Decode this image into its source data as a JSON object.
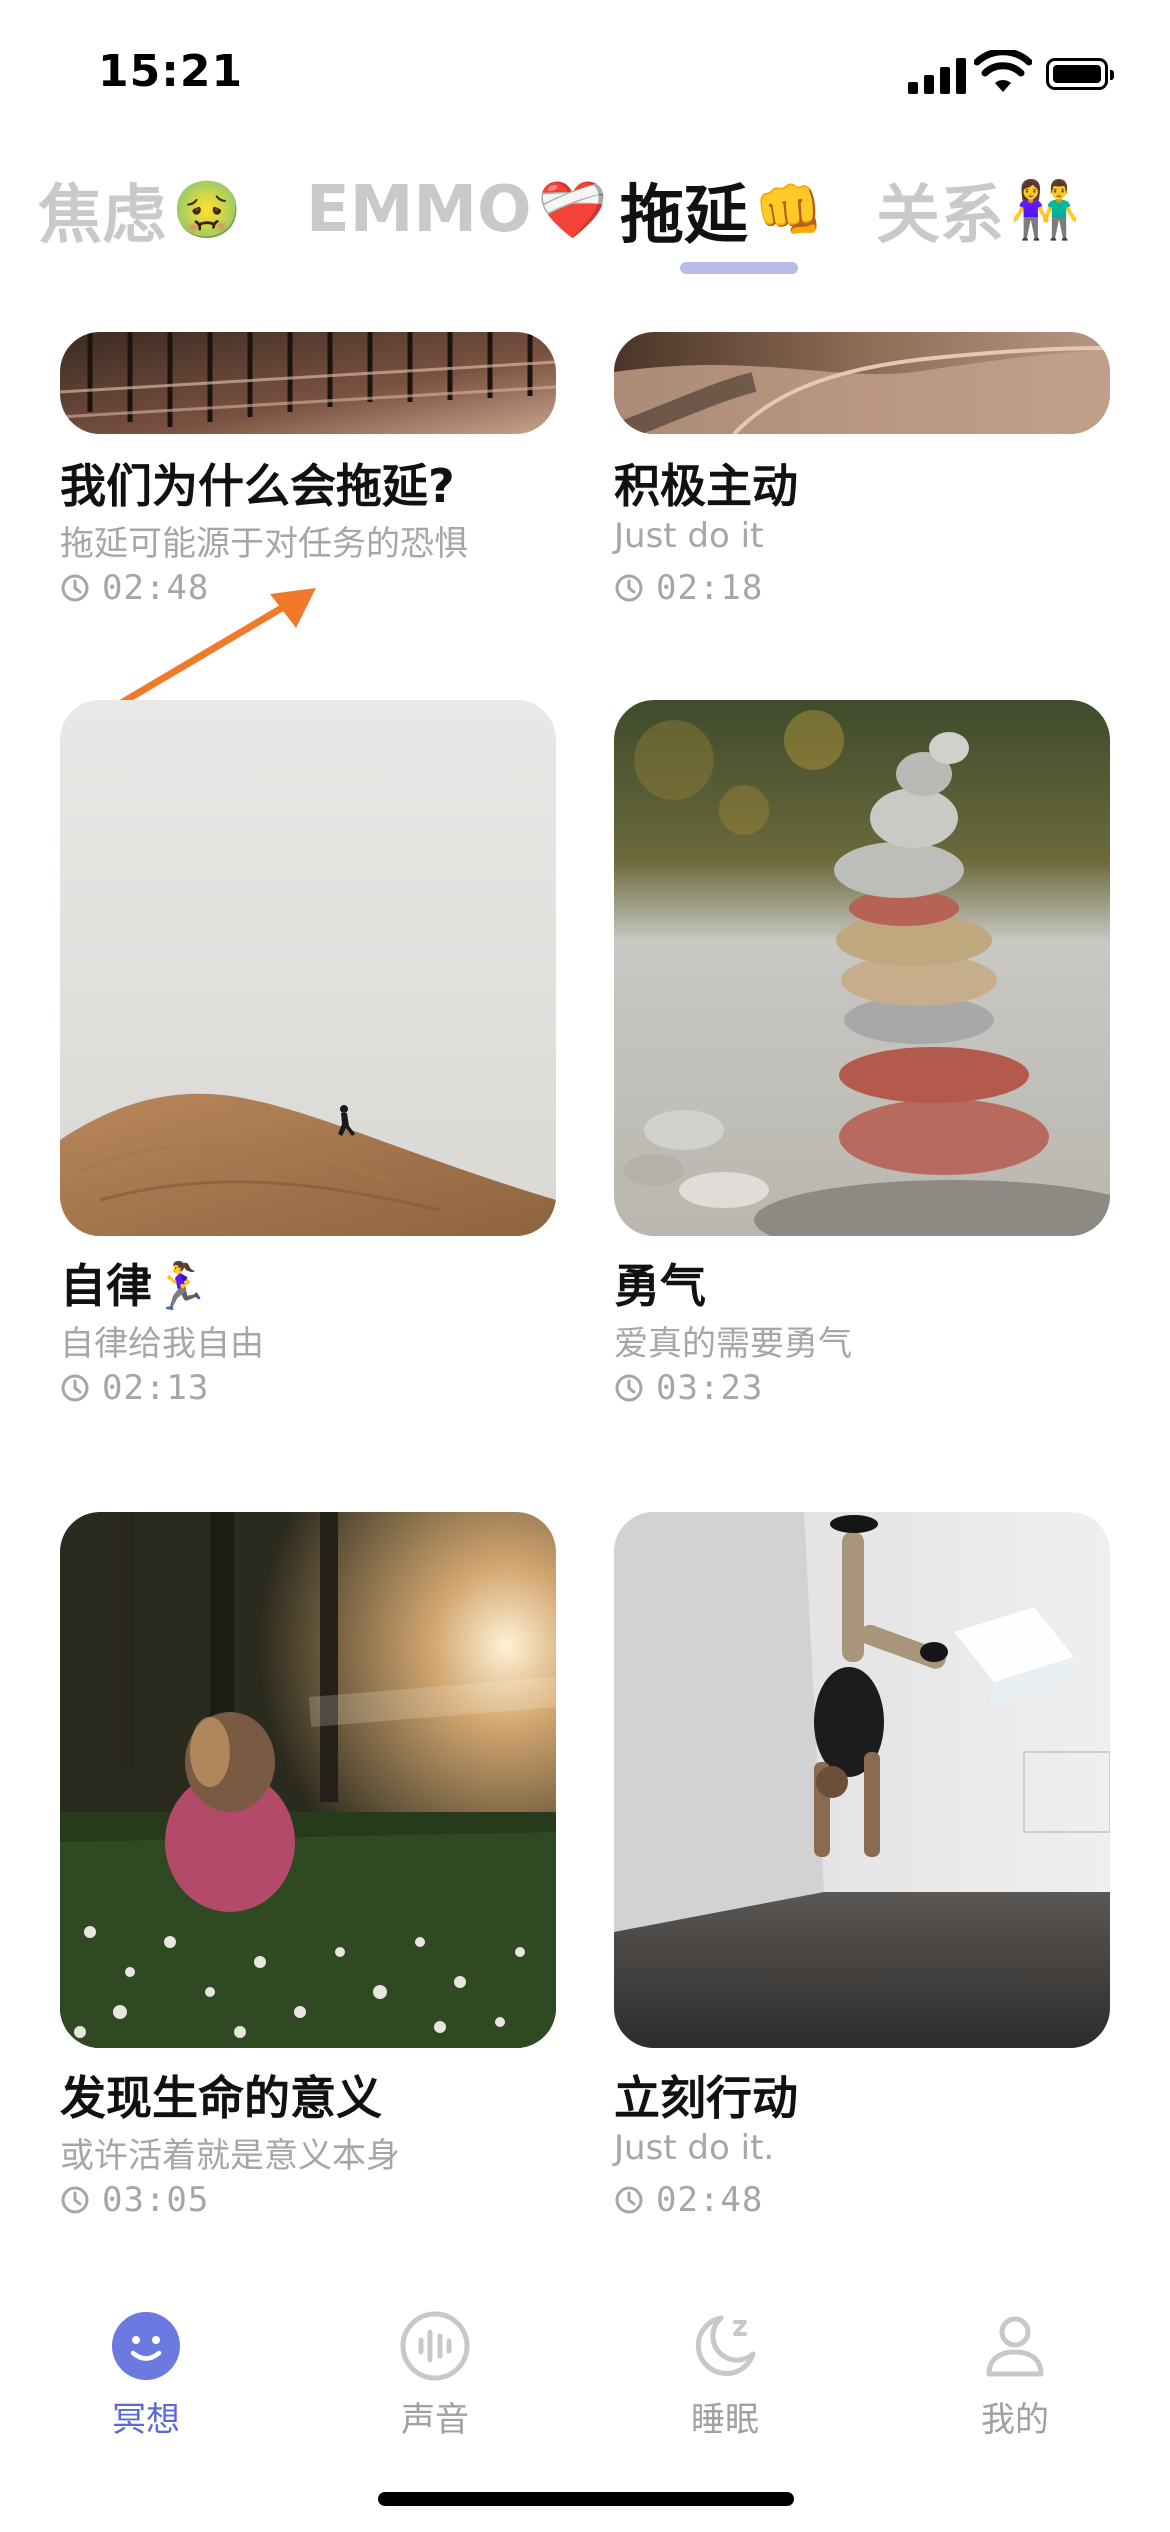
{
  "status_bar": {
    "time": "15:21"
  },
  "tabs": [
    {
      "label": "焦虑",
      "emoji": "🤢",
      "active": false
    },
    {
      "label": "EMMO",
      "emoji": "❤️‍🩹",
      "active": false
    },
    {
      "label": "拖延",
      "emoji": "👊",
      "active": true
    },
    {
      "label": "关系",
      "emoji": "👫",
      "active": false
    }
  ],
  "cards": [
    {
      "title": "我们为什么会拖延?",
      "subtitle": "拖延可能源于对任务的恐惧",
      "duration": "02:48",
      "image": "parking-structure-photo"
    },
    {
      "title": "积极主动",
      "subtitle": "Just do it",
      "duration": "02:18",
      "image": "curved-ramp-photo"
    },
    {
      "title": "自律🏃‍♀️",
      "subtitle": "自律给我自由",
      "duration": "02:13",
      "image": "runner-on-hill-photo"
    },
    {
      "title": "勇气",
      "subtitle": "爱真的需要勇气",
      "duration": "03:23",
      "image": "stacked-stones-photo"
    },
    {
      "title": "发现生命的意义",
      "subtitle": "或许活着就是意义本身",
      "duration": "03:05",
      "image": "girl-in-meadow-photo"
    },
    {
      "title": "立刻行动",
      "subtitle": "Just do it.",
      "duration": "02:48",
      "image": "handstand-gallery-photo"
    }
  ],
  "bottom_nav": [
    {
      "label": "冥想",
      "icon": "smile-face-icon",
      "active": true
    },
    {
      "label": "声音",
      "icon": "sound-wave-icon",
      "active": false
    },
    {
      "label": "睡眠",
      "icon": "moon-sleep-icon",
      "active": false
    },
    {
      "label": "我的",
      "icon": "person-icon",
      "active": false
    }
  ],
  "colors": {
    "accent": "#5b6ad9",
    "indicator": "#b7bde8",
    "muted": "#a6a6a6"
  }
}
